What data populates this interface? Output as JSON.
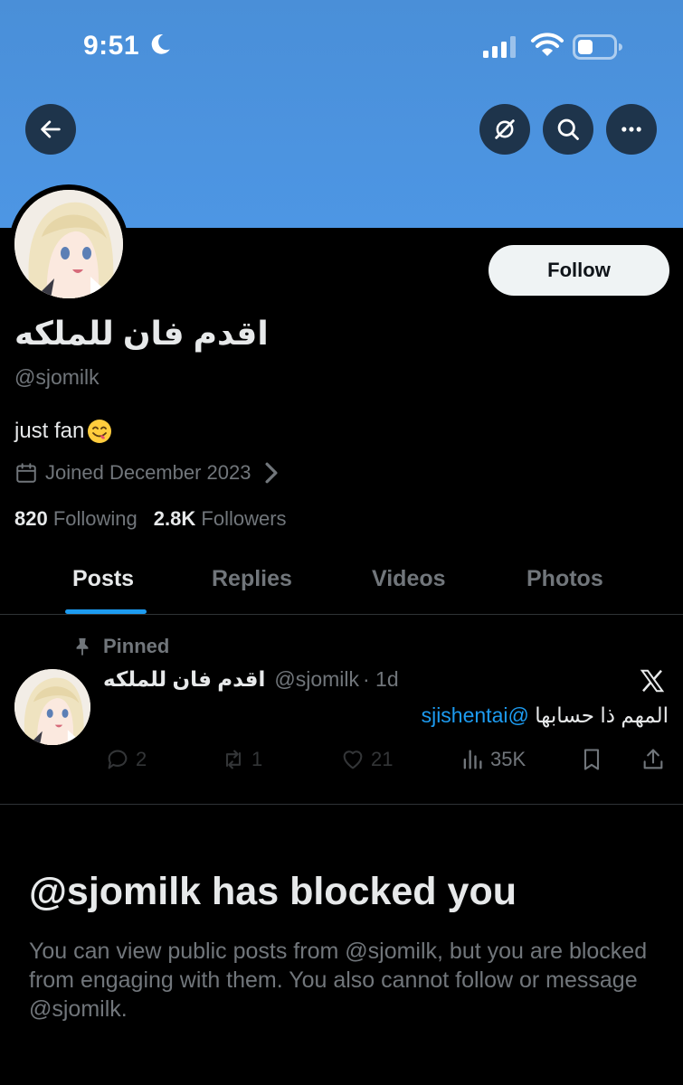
{
  "status_bar": {
    "time": "9:51"
  },
  "header": {
    "follow_label": "Follow"
  },
  "profile": {
    "display_name": "اقدم فان للملكه",
    "handle": "@sjomilk",
    "bio": "just fan",
    "joined": "Joined December 2023",
    "following_count": "820",
    "following_label": "Following",
    "followers_count": "2.8K",
    "followers_label": "Followers"
  },
  "tabs": [
    {
      "label": "Posts",
      "active": true
    },
    {
      "label": "Replies",
      "active": false
    },
    {
      "label": "Videos",
      "active": false
    },
    {
      "label": "Photos",
      "active": false
    }
  ],
  "pinned_post": {
    "pinned_label": "Pinned",
    "author_name": "اقدم فان للملكه",
    "author_handle": "@sjomilk",
    "time": "· 1d",
    "text_mention": "@sjishentai",
    "text_body": "المهم ذا حسابها",
    "replies": "2",
    "reposts": "1",
    "likes": "21",
    "views": "35K"
  },
  "blocked": {
    "title": "@sjomilk has blocked you",
    "message": "You can view public posts from @sjomilk, but you are blocked from engaging with them. You also cannot follow or message @sjomilk."
  },
  "colors": {
    "banner": "#4d96e4",
    "background": "#000000",
    "accent": "#1d9bf0",
    "muted": "#71767b",
    "text": "#e7e9ea"
  }
}
